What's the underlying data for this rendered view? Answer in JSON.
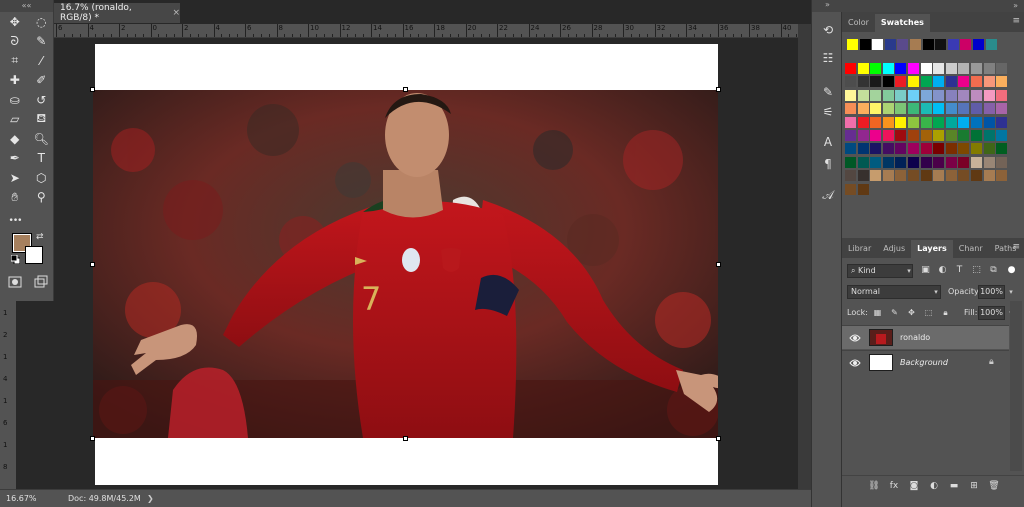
{
  "document": {
    "tab_title": "16.7% (ronaldo, RGB/8) *",
    "tab_close": "×"
  },
  "toolbar": {
    "collapse": "««",
    "more_tools": "•••",
    "foreground_color": "#a6805e",
    "background_color": "#ffffff",
    "tools": [
      [
        "move-tool",
        "marquee-tool"
      ],
      [
        "lasso-tool",
        "quick-selection-tool"
      ],
      [
        "crop-tool",
        "eyedropper-tool"
      ],
      [
        "healing-brush-tool",
        "brush-tool"
      ],
      [
        "clone-stamp-tool",
        "history-brush-tool"
      ],
      [
        "eraser-tool",
        "paint-bucket-tool"
      ],
      [
        "blur-tool",
        "dodge-tool"
      ],
      [
        "pen-tool",
        "type-tool"
      ],
      [
        "path-selection-tool",
        "shape-tool"
      ],
      [
        "hand-tool",
        "zoom-tool"
      ]
    ]
  },
  "ruler": {
    "top_labels": [
      "6",
      "4",
      "2",
      "0",
      "2",
      "4",
      "6",
      "8",
      "10",
      "12",
      "14",
      "16",
      "18",
      "20",
      "22",
      "24",
      "26",
      "28",
      "30",
      "32",
      "34",
      "36",
      "38",
      "40"
    ],
    "left_labels": [
      "1",
      "2",
      "1",
      "4",
      "1",
      "6",
      "1",
      "8"
    ]
  },
  "status": {
    "zoom": "16.67%",
    "doc_info": "Doc: 49.8M/45.2M",
    "arrow": "❯"
  },
  "panels": {
    "collapse": "»",
    "top_tabs": [
      {
        "label": "Color",
        "active": false
      },
      {
        "label": "Swatches",
        "active": true
      }
    ],
    "menu_icon": "≡",
    "layer_tabs": [
      {
        "label": "Librar",
        "active": false
      },
      {
        "label": "Adjus",
        "active": false
      },
      {
        "label": "Layers",
        "active": true
      },
      {
        "label": "Chanr",
        "active": false
      },
      {
        "label": "Paths",
        "active": false
      }
    ]
  },
  "swatches": {
    "recent": [
      "#ffff00",
      "#000000",
      "#ffffff",
      "#2a3a8c",
      "#5a4a8c",
      "#a67c52",
      "#000000",
      "#111111",
      "#3a3ab4",
      "#cc0066",
      "#0000cc",
      "#2a8c8c"
    ],
    "rows": [
      [
        "#ff0000",
        "#ffff00",
        "#00ff00",
        "#00ffff",
        "#0000ff",
        "#ff00ff",
        "#ffffff",
        "#e6e6e6",
        "#cccccc",
        "#b3b3b3",
        "#999999",
        "#808080",
        "#666666"
      ],
      [
        "#4d4d4d",
        "#333333",
        "#1a1a1a",
        "#000000",
        "#ed1c24",
        "#fff200",
        "#00a651",
        "#00aeef",
        "#2e3192",
        "#ec008c",
        "#f26c4f",
        "#f7977a",
        "#fbaf5d"
      ],
      [
        "#fff799",
        "#c4df9b",
        "#a3d39c",
        "#82ca9c",
        "#7accc8",
        "#6dcff6",
        "#7da7d9",
        "#8393ca",
        "#8781bd",
        "#a187be",
        "#bd8cbf",
        "#f49ac1",
        "#f26d7d"
      ],
      [
        "#f68e56",
        "#fbaf5d",
        "#fff568",
        "#acd373",
        "#7cc576",
        "#3cb878",
        "#1cbbb4",
        "#00bff3",
        "#448ccb",
        "#5674b9",
        "#605ca8",
        "#8560a8",
        "#a864a8"
      ],
      [
        "#f06eaa",
        "#ed1c24",
        "#f26522",
        "#f7941d",
        "#fff200",
        "#8dc63f",
        "#39b54a",
        "#00a651",
        "#00a99d",
        "#00aeef",
        "#0072bc",
        "#0054a6",
        "#2e3192"
      ],
      [
        "#662d91",
        "#92278f",
        "#ec008c",
        "#ed145b",
        "#9e0b0f",
        "#a0410d",
        "#a36209",
        "#aba000",
        "#598527",
        "#197b30",
        "#007236",
        "#00746b",
        "#0076a3"
      ],
      [
        "#004a80",
        "#003471",
        "#1b1464",
        "#440e62",
        "#630460",
        "#9e005d",
        "#9e0039",
        "#790000",
        "#7b2e00",
        "#7d4900",
        "#827b00",
        "#406618",
        "#005e20"
      ],
      [
        "#005826",
        "#005952",
        "#005b7f",
        "#003663",
        "#002157",
        "#0d004c",
        "#32004b",
        "#4b0049",
        "#7b0046",
        "#7a0026",
        "#c7b299",
        "#998675",
        "#736357"
      ],
      [
        "#534741",
        "#37302d",
        "#c69c6d",
        "#a67c52",
        "#8c6239",
        "#754c24",
        "#603913",
        "#a67c52",
        "#8c6239",
        "#754c24",
        "#603913",
        "#a67c52",
        "#8c6239"
      ],
      [
        "#754c24",
        "#603913"
      ]
    ]
  },
  "layers": {
    "filter_kind": "Kind",
    "blend_mode": "Normal",
    "opacity_label": "Opacity:",
    "opacity_value": "100%",
    "lock_label": "Lock:",
    "fill_label": "Fill:",
    "fill_value": "100%",
    "items": [
      {
        "name": "ronaldo",
        "selected": true,
        "locked": false
      },
      {
        "name": "Background",
        "selected": false,
        "locked": true
      }
    ]
  }
}
